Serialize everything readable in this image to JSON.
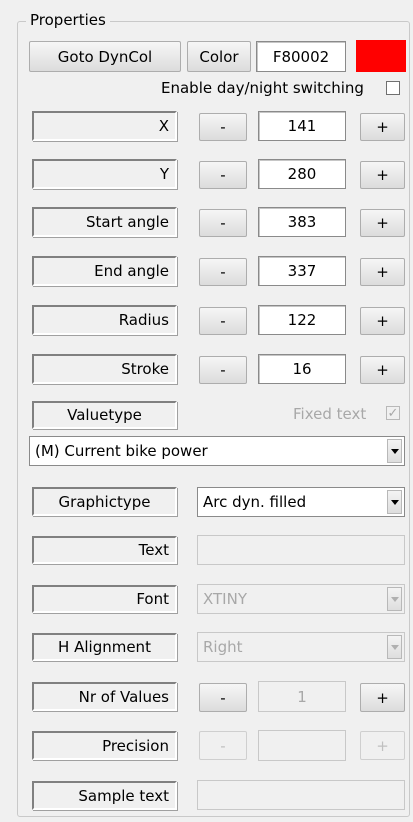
{
  "group": {
    "title": "Properties"
  },
  "top": {
    "goto_label": "Goto DynCol",
    "color_label": "Color",
    "color_value": "F80002",
    "swatch_color": "#ff0000",
    "day_night_label": "Enable day/night switching"
  },
  "rows": {
    "x": {
      "label": "X",
      "minus": "-",
      "value": "141",
      "plus": "+"
    },
    "y": {
      "label": "Y",
      "minus": "-",
      "value": "280",
      "plus": "+"
    },
    "start_angle": {
      "label": "Start angle",
      "minus": "-",
      "value": "383",
      "plus": "+"
    },
    "end_angle": {
      "label": "End angle",
      "minus": "-",
      "value": "337",
      "plus": "+"
    },
    "radius": {
      "label": "Radius",
      "minus": "-",
      "value": "122",
      "plus": "+"
    },
    "stroke": {
      "label": "Stroke",
      "minus": "-",
      "value": "16",
      "plus": "+"
    }
  },
  "valuetype": {
    "label": "Valuetype",
    "fixed_text_label": "Fixed text",
    "selected": "(M) Current bike power"
  },
  "graphictype": {
    "label": "Graphictype",
    "selected": "Arc dyn. filled"
  },
  "text": {
    "label": "Text",
    "value": ""
  },
  "font": {
    "label": "Font",
    "selected": "XTINY"
  },
  "h_alignment": {
    "label": "H Alignment",
    "selected": "Right"
  },
  "nr_values": {
    "label": "Nr of Values",
    "minus": "-",
    "value": "1",
    "plus": "+"
  },
  "precision": {
    "label": "Precision",
    "minus": "-",
    "value": "",
    "plus": "+"
  },
  "sample_text": {
    "label": "Sample text",
    "value": ""
  }
}
